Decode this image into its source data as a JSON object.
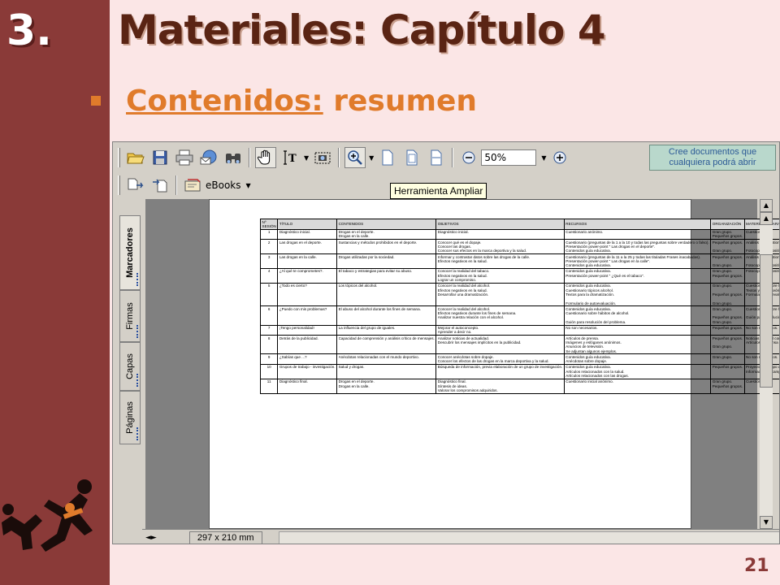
{
  "slide": {
    "number": "3.",
    "title": "Materiales: Capítulo 4",
    "subtitle_link": "Contenidos:",
    "subtitle_rest": " resumen",
    "page_number": "21"
  },
  "viewer": {
    "zoom_value": "50%",
    "ebooks_label": "eBooks",
    "tooltip": "Herramienta Ampliar",
    "ad_banner": "Cree documentos que cualquiera podrá abrir",
    "page_size": "297 x 210 mm",
    "side_tabs": [
      "Marcadores",
      "Firmas",
      "Capas",
      "Páginas"
    ],
    "icons": {
      "open": "folder-open-icon",
      "save": "save-icon",
      "print": "printer-icon",
      "email": "email-icon",
      "search": "binoculars-icon",
      "hand": "hand-icon",
      "text_select": "text-select-icon",
      "snapshot": "camera-icon",
      "zoom_in": "zoom-in-icon",
      "zoom_out": "zoom-out-icon"
    }
  },
  "document": {
    "headers": [
      "Nº SESIÓN",
      "TÍTULO",
      "CONTENIDOS",
      "OBJETIVOS",
      "RECURSOS",
      "ORGANIZACIÓN",
      "MATERIALES PARA EL ALUMNO"
    ],
    "rows": [
      [
        "1",
        "Diagnóstico inicial.",
        "Drogas en el deporte.\nDrogas en la calle.",
        "Diagnóstico inicial.",
        "Cuestionario anónimo.",
        "Gran grupo.\nPequeños grupos.",
        "Cuestionario."
      ],
      [
        "2",
        "Las drogas en el deporte.",
        "Sustancias y métodos prohibidos en el deporte.",
        "Conocer qué es el dopaje.\nConocer las drogas.\nConocer sus efectos en la marca deportiva y la salud.",
        "Cuestionario (preguntas de la 1 a la 10 y todas las preguntas sobre verdadero o falso).\nPresentación power-point \" Las drogas en el deporte\".\nContenidos guía educativa.",
        "Pequeños grupos.\n\nGran grupo.",
        "Análisis del cuestionario anónimo.\n\nFotocopias diapositivas dopaje."
      ],
      [
        "3",
        "Las drogas en la calle.",
        "Drogas utilizadas por la sociedad.",
        "Informar y contrastar datos sobre las drogas de la calle.\nEfectos negativos en la salud.",
        "Cuestionario (preguntas de la 11 a la 25 y todas las tituladas Frases inacabadas).\nPresentación power-point \" Las drogas en la calle\".\nContenidos guía educativa.",
        "Pequeños grupos.\n\nGran grupo.",
        "Análisis del cuestionario anónimo.\n\nFotocopias diapositivas drogas en la calle."
      ],
      [
        "4",
        "¿Al qué te comprometes?.",
        "El tabaco y estrategias para evitar su abuso.",
        "Conocer la realidad del tabaco.\nEfectos negativos en la salud.\nLograr un compromiso.",
        "Contenidos guía educativa.\nPresentación power-point \" ¿Qué es el tabaco\".",
        "Gran grupo.\nPequeños grupos.",
        "Fotocopias diapositivas sobre el tabaco."
      ],
      [
        "5",
        "¿Todo es cierto?",
        "Los tópicos del alcohol.",
        "Conocer la realidad del alcohol.\nEfectos negativos en la salud.\nDesarrollar una dramatización.",
        "Contenidos guía educativa.\nCuestionario tópicos alcohol.\nTextos para la dramatización.\n\nFormulario de autoevaluación.",
        "Gran grupo.\n\nPequeños grupos.\n\nGran grupo.",
        "Cuestionario sobre los tópicos del alcohol.\nTextos y marco teórico para la dramatización.\nFormulario autoevaluación dramatizaciones."
      ],
      [
        "6",
        "¿Puedo con mis problemas?",
        "El abuso del alcohol durante los fines de semana.",
        "Conocer la realidad del alcohol.\nEfectos negativos durante los fines de semana.\nAnalizar nuestra relación con el alcohol.",
        "Contenidos guía educativa.\nCuestionario sobre hábitos de alcohol.\n\nGuión para resolución del problema.",
        "Gran grupo.\n\nPequeños grupos.\nGran grupo.",
        "Cuestionario sobre hábitos de alcohol.\n\nGuión para resolución del problema."
      ],
      [
        "7",
        "¡Tengo personalidad!",
        "La influencia del grupo de iguales.",
        "Mejorar el autoconcepto.\nAprender a decir no.",
        "No son necesarios.",
        "Pequeños grupos.",
        "No son necesarios."
      ],
      [
        "8",
        "Detrás de la publicidad.",
        "Capacidad de comprensión y análisis crítico de mensajes.",
        "Analizar noticias de actualidad.\nDescubrir los mensajes implícitos en la publicidad.",
        "Artículos de prensa.\nImágenes y eslóganes anónimos.\nAnuncios de televisión.\nSe adjuntan algunos ejemplos.",
        "Pequeños grupos.\n\nGran grupo.",
        "Noticias sobre el consumo de drogas.\nArtículos de prensa o televisión."
      ],
      [
        "9",
        "¿Sabías que ...?",
        "Anécdotas relacionadas con el mundo deportivo.",
        "Conocer anécdotas sobre dopaje.\nConocer los efectos de las drogas en la marca deportiva y la salud.",
        "Contenidos guía educativa.\nAnécdotas sobre dopaje.",
        "Gran grupo.",
        "No son necesarios."
      ],
      [
        "10",
        "Grupos de trabajo - investigación.",
        "Salud y drogas.",
        "Búsqueda de información, previa elaboración de un grupo de investigación.",
        "Contenidos guía educativa.\nArtículos relacionados con la salud.\nArtículos relacionados con las drogas.",
        "Pequeños grupos.",
        "Proyecto del grupo de investigación.\nInformación de campo."
      ],
      [
        "11",
        "Diagnóstico final.",
        "Drogas en el deporte.\nDrogas en la calle.",
        "Diagnóstico final.\nSíntesis de ideas.\nValorar los compromisos adquiridos.",
        "Cuestionario inicial anónimo.",
        "Gran grupo.\nPequeños grupos.",
        "Cuestionario."
      ]
    ]
  },
  "colors": {
    "left_bar": "#8a3a38",
    "background": "#fbe6e6",
    "title": "#5a2414",
    "accent": "#e07b2b"
  }
}
